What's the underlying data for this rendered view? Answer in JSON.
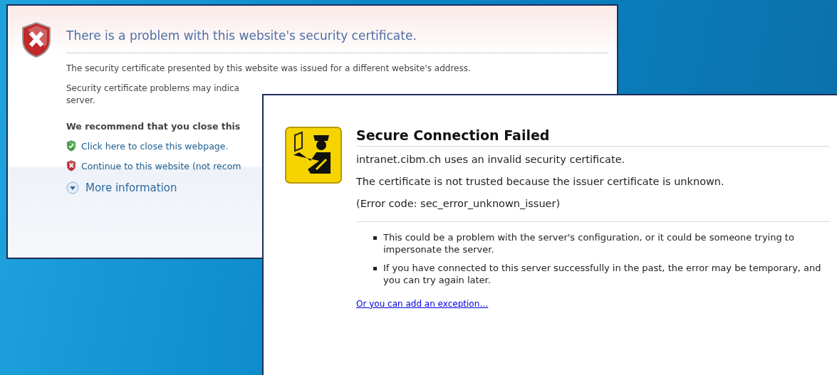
{
  "ie_page": {
    "title": "There is a problem with this website's security certificate.",
    "paragraphs": [
      "The security certificate presented by this website was issued for a different website's address.",
      "Security certificate problems may indica",
      "server."
    ],
    "recommendation": "We recommend that you close this",
    "links": [
      {
        "kind": "safe",
        "label": "Click here to close this webpage."
      },
      {
        "kind": "unsafe",
        "label": "Continue to this website (not recom"
      }
    ],
    "more_information": "More information"
  },
  "firefox_page": {
    "title": "Secure Connection Failed",
    "message": "intranet.cibm.ch uses an invalid security certificate.",
    "detail": "The certificate is not trusted because the issuer certificate is unknown.",
    "error_code": "(Error code: sec_error_unknown_issuer)",
    "bullets": [
      "This could be a problem with the server's configuration, or it could be someone trying to impersonate the server.",
      "If you have connected to this server successfully in the past, the error may be temporary, and you can try again later."
    ],
    "exception_link": "Or you can add an exception…"
  }
}
